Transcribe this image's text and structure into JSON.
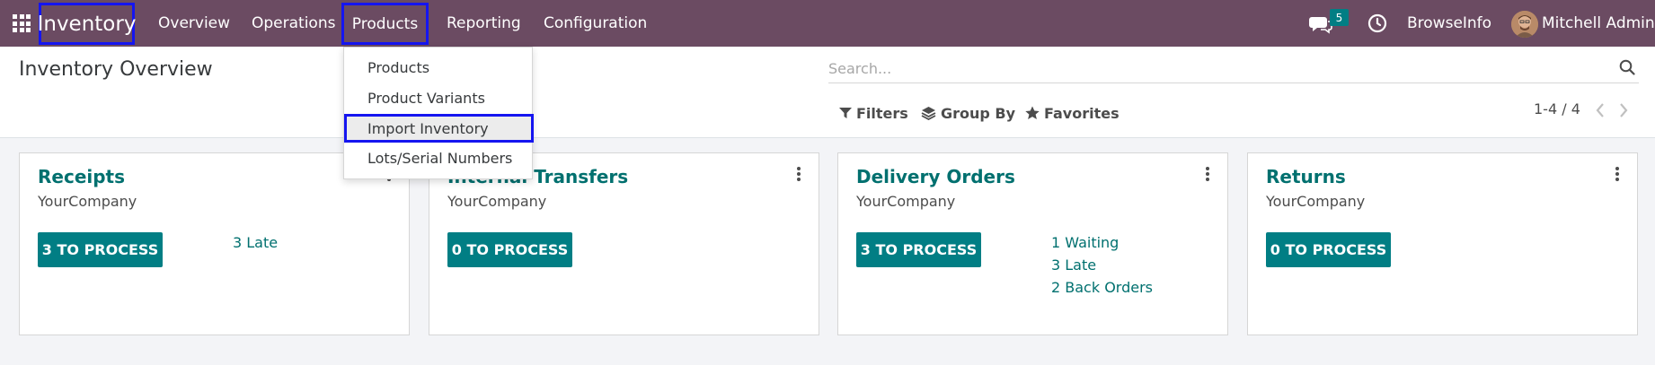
{
  "navbar": {
    "brand": "Inventory",
    "menu": [
      "Overview",
      "Operations",
      "Products",
      "Reporting",
      "Configuration"
    ],
    "chat_count": "5",
    "company": "BrowseInfo",
    "user": "Mitchell Admin"
  },
  "dropdown": {
    "items": [
      "Products",
      "Product Variants",
      "Import Inventory",
      "Lots/Serial Numbers"
    ],
    "active_item": "Import Inventory"
  },
  "control_panel": {
    "title": "Inventory Overview",
    "search_placeholder": "Search...",
    "filters_label": "Filters",
    "groupby_label": "Group By",
    "favorites_label": "Favorites",
    "pager": "1-4 / 4"
  },
  "cards": [
    {
      "title": "Receipts",
      "company": "YourCompany",
      "button": "3 TO PROCESS",
      "stats": [
        "3 Late"
      ]
    },
    {
      "title": "Internal Transfers",
      "company": "YourCompany",
      "button": "0 TO PROCESS",
      "stats": []
    },
    {
      "title": "Delivery Orders",
      "company": "YourCompany",
      "button": "3 TO PROCESS",
      "stats": [
        "1 Waiting",
        "3 Late",
        "2 Back Orders"
      ]
    },
    {
      "title": "Returns",
      "company": "YourCompany",
      "button": "0 TO PROCESS",
      "stats": []
    }
  ],
  "colors": {
    "navbar": "#6b4b62",
    "accent": "#017e84",
    "link": "#00706f",
    "highlight_box": "#1515f0"
  },
  "icons": [
    "apps-grid-icon",
    "chat-icon",
    "clock-icon",
    "search-icon",
    "filter-icon",
    "layers-icon",
    "star-icon",
    "chevron-left-icon",
    "chevron-right-icon",
    "kebab-menu-icon"
  ]
}
